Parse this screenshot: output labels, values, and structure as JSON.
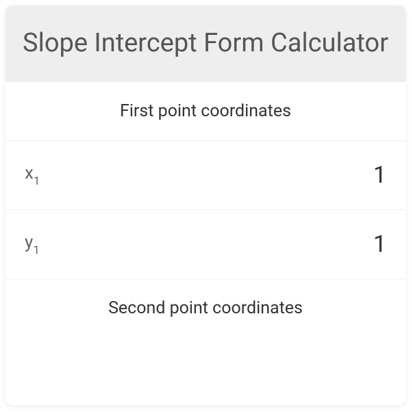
{
  "header": {
    "title": "Slope Intercept Form Calculator"
  },
  "sections": {
    "first": {
      "title": "First point coordinates",
      "x_label_base": "x",
      "x_label_sub": "1",
      "x_value": "1",
      "y_label_base": "y",
      "y_label_sub": "1",
      "y_value": "1"
    },
    "second": {
      "title": "Second point coordinates"
    }
  }
}
